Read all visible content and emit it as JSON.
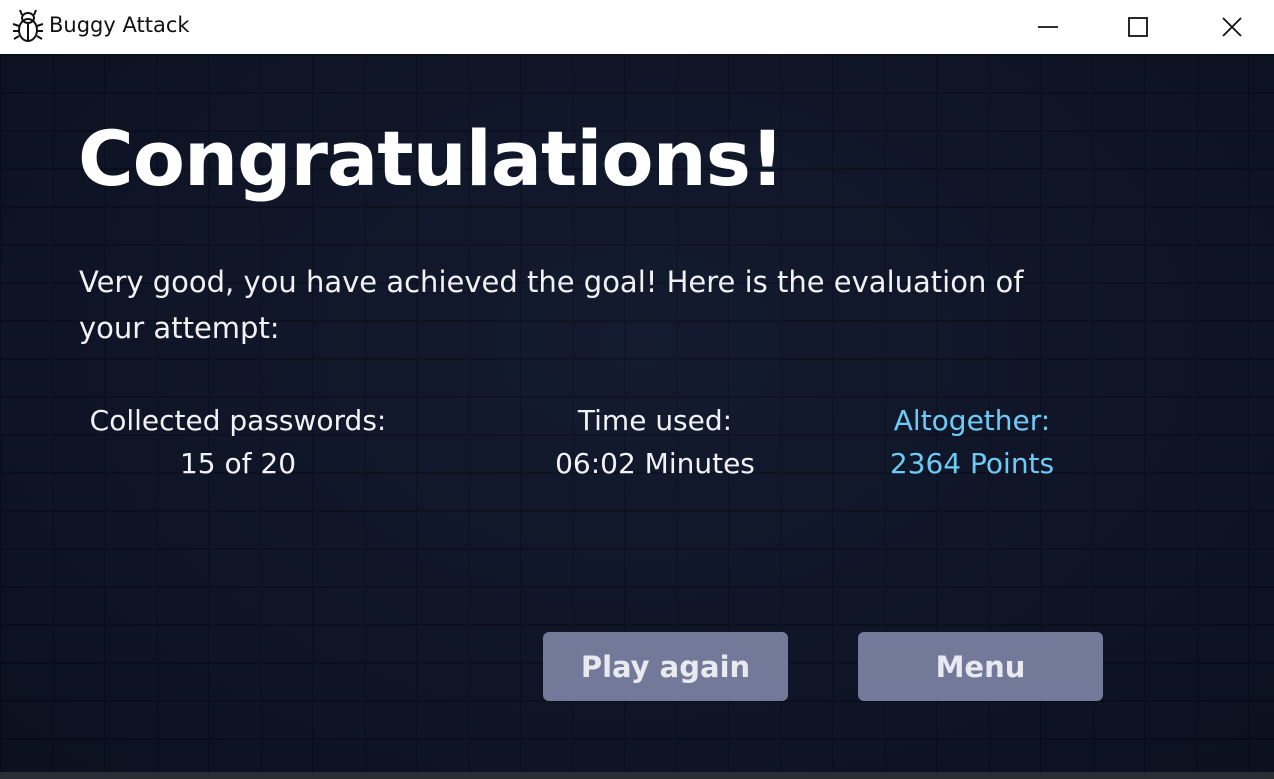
{
  "window": {
    "title": "Buggy Attack",
    "icon": "bug-icon"
  },
  "screen": {
    "heading": "Congratulations!",
    "message": "Very good, you have achieved the goal! Here is the evaluation of your attempt:",
    "stats": {
      "passwords_label": "Collected passwords:",
      "passwords_value": "15 of 20",
      "time_label": "Time used:",
      "time_value": "06:02 Minutes",
      "total_label": "Altogether:",
      "total_value": "2364 Points"
    },
    "buttons": {
      "play_again": "Play again",
      "menu": "Menu"
    }
  },
  "colors": {
    "background": "#0f1629",
    "accent": "#6ecbf5",
    "button": "#737a99"
  }
}
